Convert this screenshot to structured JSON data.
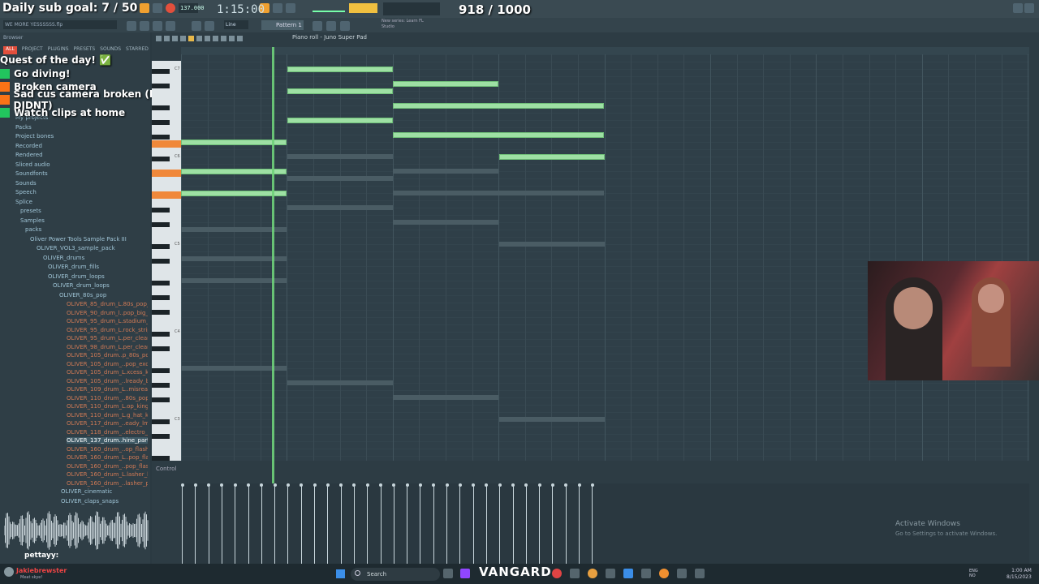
{
  "overlay": {
    "subgoal": "Daily sub goal: 7 / 50",
    "counter": "918 / 1000",
    "quest_title": "Quest of the day! ✅",
    "quests": [
      {
        "label": "Go diving!",
        "color": "#22c55e"
      },
      {
        "label": "Broken camera",
        "color": "#f97316"
      },
      {
        "label": "Sad cus camera broken (IT DIDNT)",
        "color": "#f97316"
      },
      {
        "label": "Watch clips at home",
        "color": "#22c55e"
      }
    ]
  },
  "toolbar": {
    "time": "1:15:00",
    "pattern": "Pattern 1",
    "snap": "Line",
    "tempo": "137.000",
    "news": "New series: Learn FL Studio"
  },
  "pianoroll": {
    "title": "Piano roll - Juno Super Pad",
    "control_label": "Control",
    "octave_labels": [
      "C7",
      "C6",
      "C5",
      "C4",
      "C3"
    ]
  },
  "browser": {
    "header": "Browser",
    "tabs": [
      "ALL",
      "PROJECT",
      "PLUGINS",
      "PRESETS",
      "SOUNDS",
      "STARRED"
    ],
    "hint_text": "WE MORE YESSSSSS.flp",
    "tree": [
      "My projects",
      "Packs",
      "Project bones",
      "Recorded",
      "Rendered",
      "Sliced audio",
      "Soundfonts",
      "Sounds",
      "Speech",
      "Splice",
      "presets",
      "Samples",
      "packs",
      "Oliver Power Tools Sample Pack III",
      "OLIVER_VOL3_sample_pack",
      "OLIVER_drums",
      "OLIVER_drum_fills",
      "OLIVER_drum_loops",
      "OLIVER_drum_loops",
      "OLIVER_80s_pop"
    ],
    "files": [
      "OLIVER_85_drum_L.80s_pop_def_rock",
      "OLIVER_90_drum_l..pop_big_hair_rock",
      "OLIVER_95_drum_L.stadium_rock_full",
      "OLIVER_95_drum_L.rock_stripped_dry",
      "OLIVER_95_drum_L.per_clean_simple",
      "OLIVER_98_drum_L.per_clean_simple",
      "OLIVER_105_drum..p_80s_pop_excess",
      "OLIVER_105_drum_..pop_excess_flats",
      "OLIVER_105_drum_L.xcess_kick_snare",
      "OLIVER_105_drum_..lready_bombastic",
      "OLIVER_109_drum_L..misready_get_it",
      "OLIVER_110_drum_..80s_pop_king_hut",
      "OLIVER_110_drum_L.op_king_hat_flats",
      "OLIVER_110_drum_L.g_hat_kick_snare",
      "OLIVER_117_drum_..eady_lm1_vintage",
      "OLIVER_118_drum_..electro_slammed",
      "OLIVER_137_drum..hine_party_down",
      "OLIVER_160_drum_..op_flasher_flange",
      "OLIVER_160_drum_L..pop_flasher_full",
      "OLIVER_160_drum_..pop_flasher_flats",
      "OLIVER_160_drum_L.lasher_kick_snare",
      "OLIVER_160_drum_..lasher_percussion"
    ],
    "tree_bottom": [
      "OLIVER_cinematic",
      "OLIVER_claps_snaps"
    ],
    "chat_user": "pettayy:"
  },
  "webcam_alt": "Webcam of two people in a room",
  "windows": {
    "activate": "Activate Windows",
    "activate_hint": "Go to Settings to activate Windows.",
    "search": "Search",
    "vangard": "VANGARD",
    "lang": "ENG\nNO",
    "clock_time": "1:00 AM",
    "clock_date": "8/15/2023",
    "bottom_left_user": "Jakiebrewster",
    "bottom_left_sub": "Meat skye!"
  }
}
